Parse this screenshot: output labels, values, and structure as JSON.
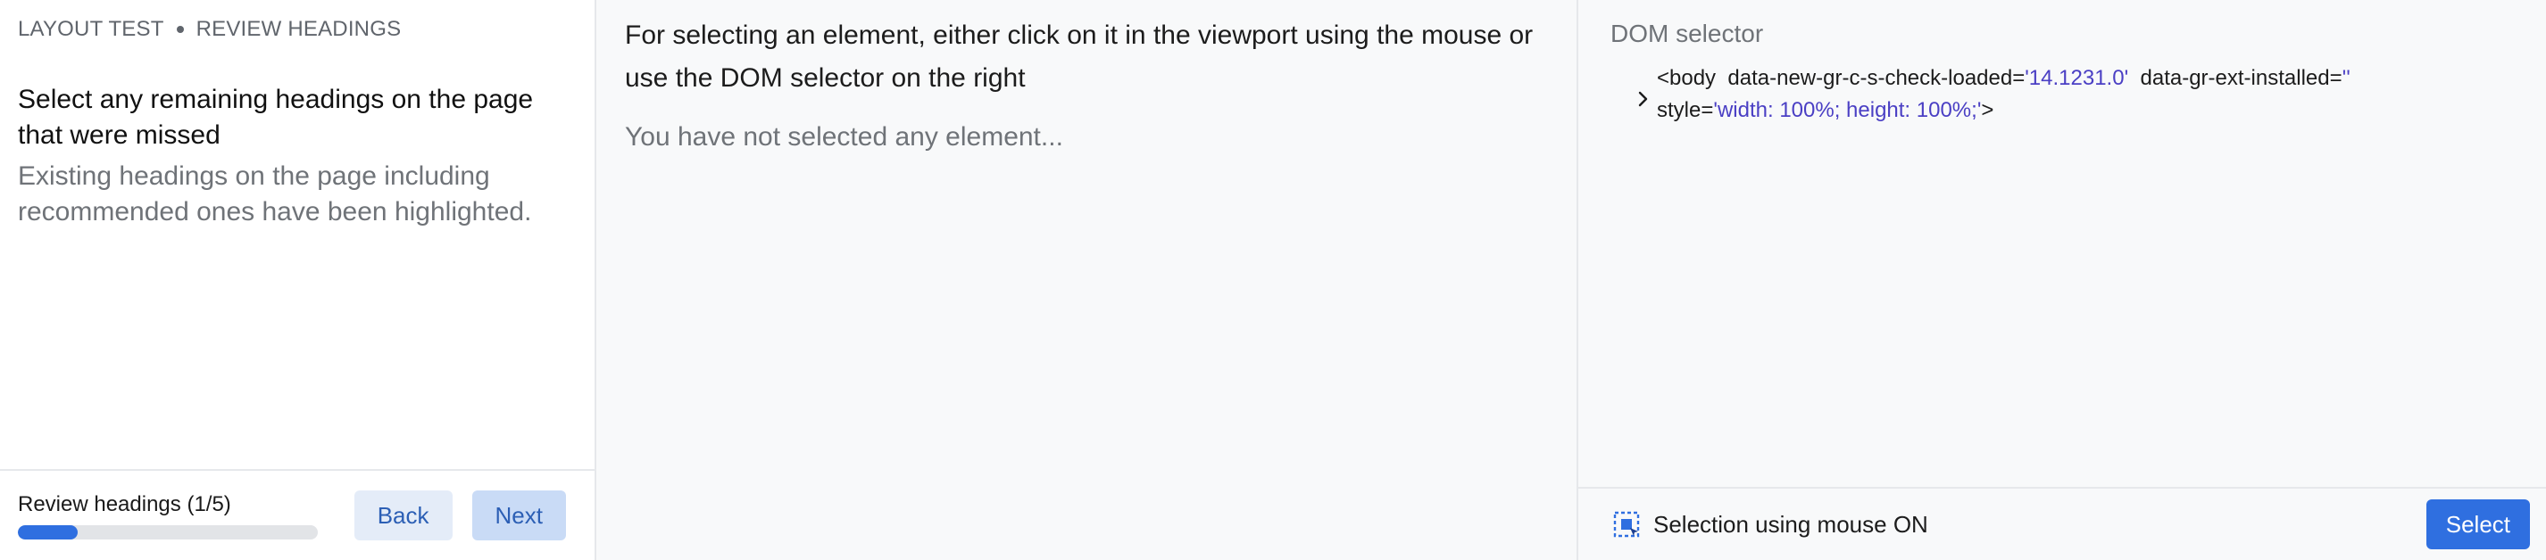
{
  "wizard": {
    "section": "LAYOUT TEST",
    "step": "REVIEW HEADINGS",
    "title": "Select any remaining headings on the page that were missed",
    "description": "Existing headings on the page including recommended ones have been highlighted.",
    "progress_label": "Review headings (1/5)",
    "progress_fraction": 0.2,
    "back_label": "Back",
    "next_label": "Next"
  },
  "viewport": {
    "instructions": "For selecting an element, either click on it in the viewport using the mouse or use the DOM selector on the right",
    "empty_state": "You have not selected any element..."
  },
  "dom_selector": {
    "title": "DOM selector",
    "node": {
      "tag_open": "<body",
      "attr1_name": "data-new-gr-c-s-check-loaded=",
      "attr1_value": "'14.1231.0'",
      "attr2_name": "data-gr-ext-installed=",
      "attr2_value": "''",
      "attr3_name": "style=",
      "attr3_value": "'width: 100%; height: 100%;'",
      "tag_close": ">"
    },
    "mouse_selection_label": "Selection using mouse ON",
    "select_label": "Select"
  },
  "colors": {
    "accent": "#2f6fe0",
    "attr_value": "#4a3fc4",
    "muted_text": "#6f7378"
  },
  "icons": {
    "expand": "chevron-right-icon",
    "mouse_selection": "selection-cursor-icon"
  }
}
